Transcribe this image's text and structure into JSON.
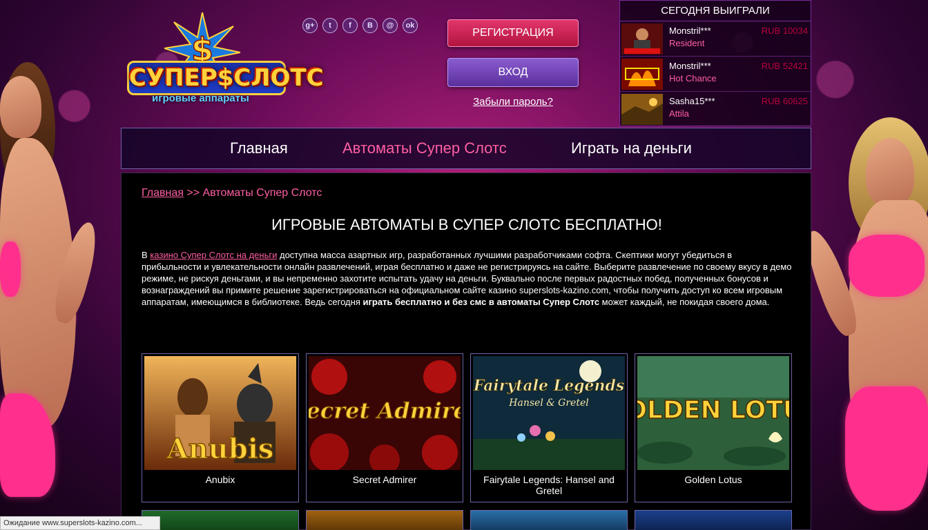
{
  "header": {
    "logo_main": "СУПЕР$СЛОТС",
    "logo_sub": "игровые аппараты",
    "socials": [
      {
        "icon": "google-plus-icon",
        "glyph": "g+"
      },
      {
        "icon": "twitter-icon",
        "glyph": "t"
      },
      {
        "icon": "facebook-icon",
        "glyph": "f"
      },
      {
        "icon": "vk-icon",
        "glyph": "B"
      },
      {
        "icon": "mail-icon",
        "glyph": "@"
      },
      {
        "icon": "odnoklassniki-icon",
        "glyph": "ok"
      }
    ],
    "register_label": "РЕГИСТРАЦИЯ",
    "login_label": "ВХОД",
    "forgot_label": "Забыли пароль?"
  },
  "winners": {
    "title": "СЕГОДНЯ ВЫИГРАЛИ",
    "items": [
      {
        "user": "Monstril***",
        "game": "Resident",
        "amount": "RUB 10034"
      },
      {
        "user": "Monstril***",
        "game": "Hot Chance",
        "amount": "RUB 52421"
      },
      {
        "user": "Sasha15***",
        "game": "Attila",
        "amount": "RUB 60625"
      }
    ]
  },
  "nav": {
    "items": [
      {
        "label": "Главная"
      },
      {
        "label": "Автоматы Супер Слотс"
      },
      {
        "label": "Играть на деньги"
      }
    ]
  },
  "breadcrumb": {
    "home": "Главная",
    "separator": " >> ",
    "current": "Автоматы Супер Слотс"
  },
  "page_title": "ИГРОВЫЕ АВТОМАТЫ В СУПЕР СЛОТС БЕСПЛАТНО!",
  "intro": {
    "prefix": "В ",
    "link": "казино Супер Слотс на деньги",
    "body": " доступна масса азартных игр, разработанных лучшими разработчиками софта. Скептики могут убедиться в прибыльности и увлекательности онлайн развлечений, играя бесплатно и даже не регистрируясь на сайте. Выберите развлечение по своему вкусу в демо режиме, не рискуя деньгами, и вы непременно захотите испытать удачу на деньги. Буквально после первых радостных побед, полученных бонусов и вознаграждений вы примите решение зарегистрироваться на официальном сайте казино superslots-kazino.com, чтобы получить доступ ко всем игровым аппаратам, имеющимся в библиотеке. Ведь сегодня ",
    "bold": "играть бесплатно и без смс в автоматы Супер Слотс",
    "suffix": " может каждый, не покидая своего дома."
  },
  "games": [
    {
      "title": "Anubix",
      "art_text": "Anubis"
    },
    {
      "title": "Secret Admirer",
      "art_text": "Secret Admirer"
    },
    {
      "title": "Fairytale Legends: Hansel and Gretel",
      "art_text": "Fairytale Legends",
      "art_sub": "Hansel & Gretel"
    },
    {
      "title": "Golden Lotus",
      "art_text": "GOLDEN LOTUS"
    }
  ],
  "status": "Ожидание www.superslots-kazino.com..."
}
